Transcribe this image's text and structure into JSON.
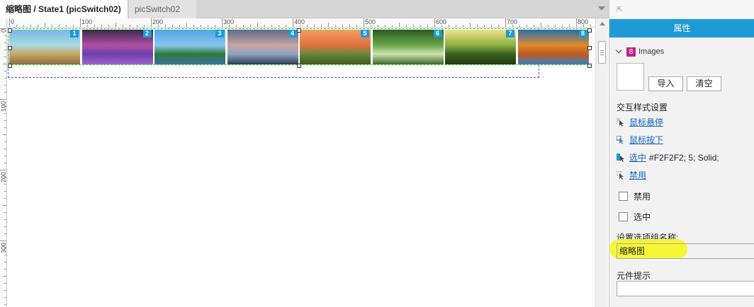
{
  "tabs": [
    {
      "label": "缩略图 / State1 (picSwitch02)",
      "close": "✕",
      "active": true
    },
    {
      "label": "picSwitch02",
      "close": "✕",
      "active": false
    }
  ],
  "ruler": {
    "h_labels": [
      "0",
      "100",
      "200",
      "300",
      "400",
      "500",
      "600",
      "700",
      "800"
    ],
    "v_labels": [
      "0",
      "100",
      "200",
      "300"
    ]
  },
  "thumbnails": [
    {
      "num": "1",
      "colors": [
        "#79b8e0",
        "#a8dce4",
        "#c6a864",
        "#8b7040"
      ]
    },
    {
      "num": "2",
      "colors": [
        "#3a2a4e",
        "#b24fa3",
        "#6a3fb0",
        "#9d63c9"
      ]
    },
    {
      "num": "3",
      "colors": [
        "#4da6e8",
        "#8ac6ef",
        "#2d7a3a",
        "#3a6f9c"
      ]
    },
    {
      "num": "4",
      "colors": [
        "#5d6f8a",
        "#c9a3a0",
        "#8fa6c4",
        "#2d3b52"
      ]
    },
    {
      "num": "5",
      "colors": [
        "#f4a060",
        "#e07040",
        "#6a8a3a",
        "#3e5a20"
      ]
    },
    {
      "num": "6",
      "colors": [
        "#2c5a1e",
        "#6aa84f",
        "#cfe0b0",
        "#3d6b28"
      ]
    },
    {
      "num": "7",
      "colors": [
        "#f4e08a",
        "#8ab040",
        "#3a6020",
        "#213a10"
      ]
    },
    {
      "num": "8",
      "colors": [
        "#2a6db0",
        "#e08a2a",
        "#c05a20",
        "#3a80c0"
      ]
    }
  ],
  "panel": {
    "header": "属性",
    "images_count": "8",
    "images_label": "Images",
    "btn_import": "导入",
    "btn_clear": "清空",
    "interaction_title": "交互样式设置",
    "state_hover": "鼠标悬停",
    "state_press": "鼠标按下",
    "state_selected": "选中",
    "state_selected_extra": "#F2F2F2; 5; Solid;",
    "state_disabled": "禁用",
    "checkbox_disabled": "禁用",
    "checkbox_selected": "选中",
    "group_name_label": "设置选项组名称:",
    "group_name_value": "缩略图",
    "tooltip_label": "元件提示",
    "tooltip_value": ""
  },
  "colors": {
    "accent": "#1e9bd7",
    "link": "#1565c0",
    "badge": "#c5218a",
    "highlight": "#f5f52c"
  }
}
